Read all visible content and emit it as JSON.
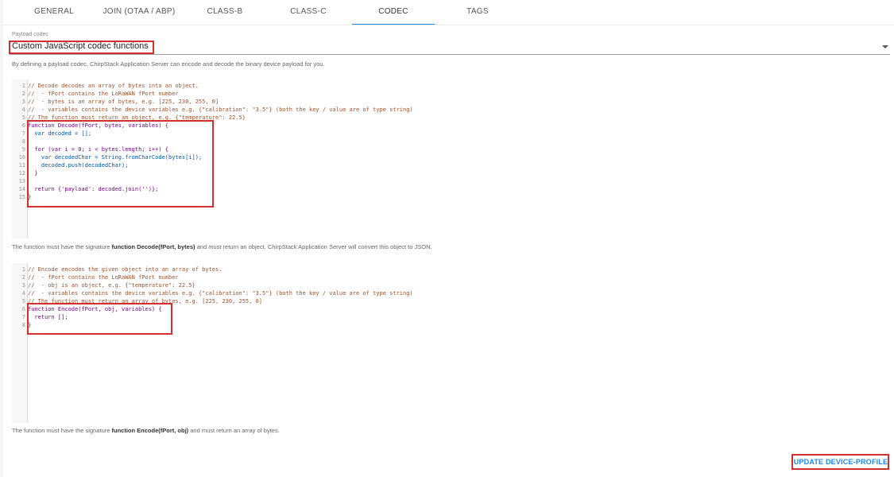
{
  "tabs": [
    {
      "label": "GENERAL"
    },
    {
      "label": "JOIN (OTAA / ABP)"
    },
    {
      "label": "CLASS-B"
    },
    {
      "label": "CLASS-C"
    },
    {
      "label": "CODEC",
      "active": true
    },
    {
      "label": "TAGS"
    }
  ],
  "payload_codec": {
    "label": "Payload codec",
    "value": "Custom JavaScript codec functions",
    "helper": "By defining a payload codec, ChirpStack Application Server can encode and decode the binary device payload for you."
  },
  "decode_editor": {
    "lines": [
      "// Decode decodes an array of bytes into an object.",
      "//  - fPort contains the LoRaWAN fPort number",
      "//  - bytes is an array of bytes, e.g. [225, 230, 255, 0]",
      "//  - variables contains the device variables e.g. {\"calibration\": \"3.5\"} (both the key / value are of type string)",
      "// The function must return an object, e.g. {\"temperature\": 22.5}",
      "function Decode(fPort, bytes, variables) {",
      "  var decoded = [];",
      "",
      "  for (var i = 0; i < bytes.length; i++) {",
      "    var decodedChar = String.fromCharCode(bytes[i]);",
      "    decoded.push(decodedChar);",
      "  }",
      "",
      "  return {'payload': decoded.join('')};",
      "}"
    ],
    "helper_prefix": "The function must have the signature ",
    "helper_sig": "function Decode(fPort, bytes)",
    "helper_suffix": " and must return an object. ChirpStack Application Server will convert this object to JSON."
  },
  "encode_editor": {
    "lines": [
      "// Encode encodes the given object into an array of bytes.",
      "//  - fPort contains the LoRaWAN fPort number",
      "//  - obj is an object, e.g. {\"temperature\": 22.5}",
      "//  - variables contains the device variables e.g. {\"calibration\": \"3.5\"} (both the key / value are of type string)",
      "// The function must return an array of bytes, e.g. [225, 230, 255, 0]",
      "function Encode(fPort, obj, variables) {",
      "  return [];",
      "}"
    ],
    "helper_prefix": "The function must have the signature ",
    "helper_sig": "function Encode(fPort, obj)",
    "helper_suffix": " and must return an array of bytes."
  },
  "update_button": {
    "label": "UPDATE DEVICE-PROFILE"
  },
  "colors": {
    "accent": "#1e88e5",
    "highlight": "#d32f2f"
  }
}
